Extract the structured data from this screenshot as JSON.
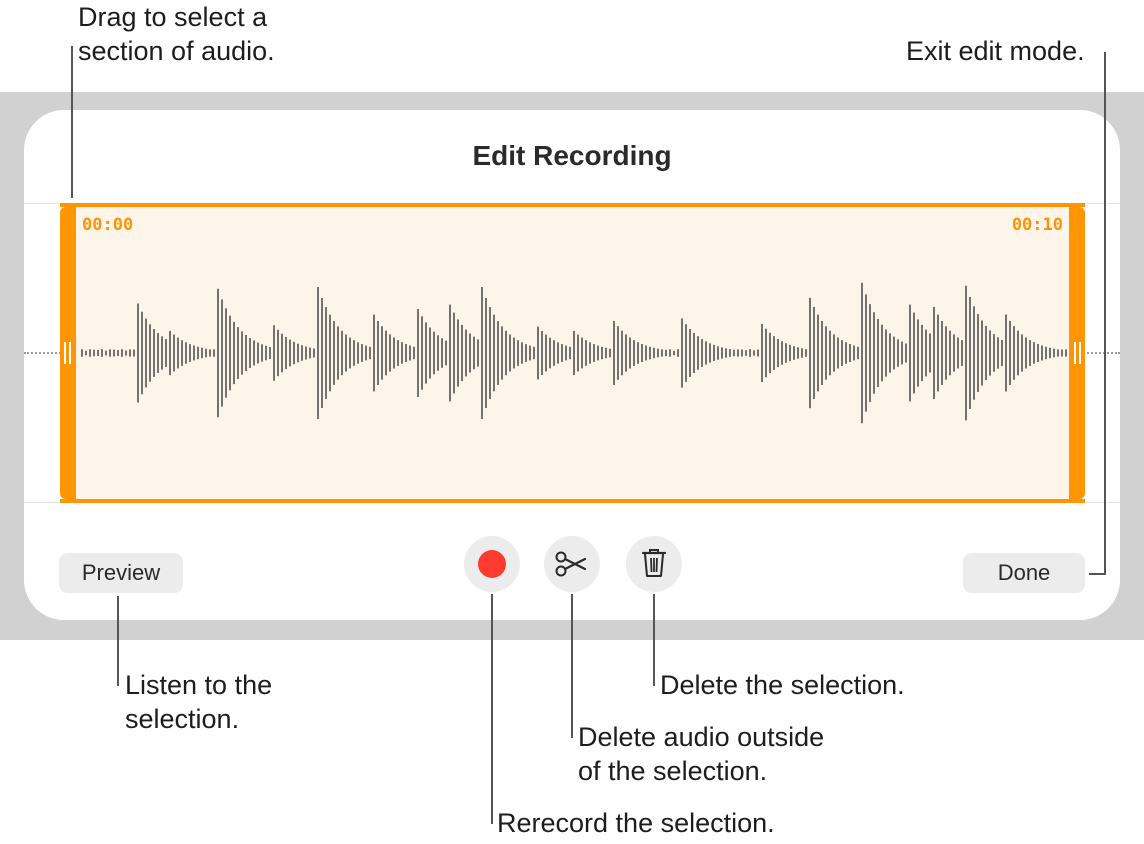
{
  "window": {
    "title": "Edit Recording"
  },
  "selection": {
    "start_time": "00:00",
    "end_time": "00:10"
  },
  "buttons": {
    "preview": "Preview",
    "done": "Done"
  },
  "icons": {
    "record": "record-icon",
    "trim": "scissors-icon",
    "delete": "trash-icon"
  },
  "callouts": {
    "drag_line1": "Drag to select a",
    "drag_line2": "section of audio.",
    "exit": "Exit edit mode.",
    "listen_line1": "Listen to the",
    "listen_line2": "selection.",
    "delete_sel": "Delete the selection.",
    "trim_line1": "Delete audio outside",
    "trim_line2": "of the selection.",
    "rerecord": "Rerecord the selection."
  },
  "colors": {
    "accent": "#ff9500",
    "record": "#ff3b30",
    "selection_fill": "#fdf4ea"
  }
}
